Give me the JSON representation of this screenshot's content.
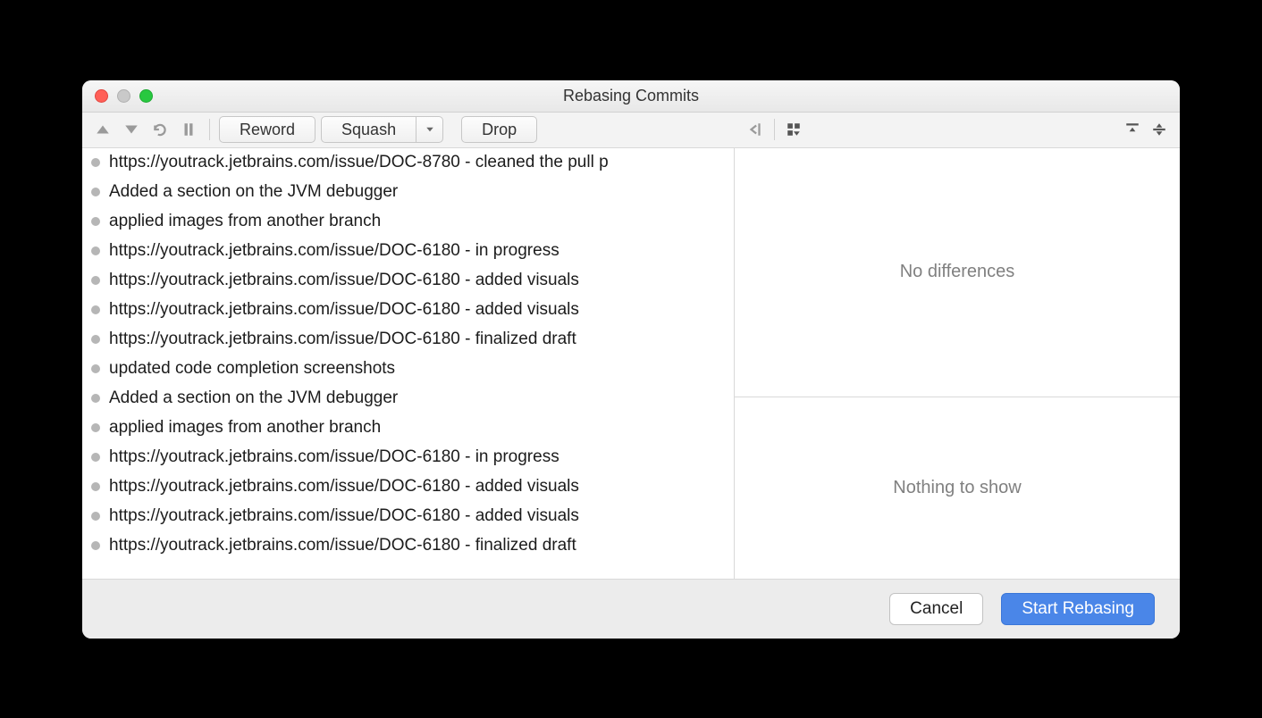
{
  "window": {
    "title": "Rebasing Commits"
  },
  "toolbar": {
    "reword": "Reword",
    "squash": "Squash",
    "drop": "Drop"
  },
  "commits": [
    "https://youtrack.jetbrains.com/issue/DOC-8780 - cleaned the pull p",
    "Added a section on the JVM debugger",
    "applied images from another branch",
    "https://youtrack.jetbrains.com/issue/DOC-6180 - in progress",
    "https://youtrack.jetbrains.com/issue/DOC-6180 - added visuals",
    "https://youtrack.jetbrains.com/issue/DOC-6180 - added visuals",
    "https://youtrack.jetbrains.com/issue/DOC-6180 - finalized draft",
    "updated code completion screenshots",
    "Added a section on the JVM debugger",
    "applied images from another branch",
    "https://youtrack.jetbrains.com/issue/DOC-6180 - in progress",
    "https://youtrack.jetbrains.com/issue/DOC-6180 - added visuals",
    "https://youtrack.jetbrains.com/issue/DOC-6180 - added visuals",
    "https://youtrack.jetbrains.com/issue/DOC-6180 - finalized draft"
  ],
  "diff": {
    "upper": "No differences",
    "lower": "Nothing to show"
  },
  "footer": {
    "cancel": "Cancel",
    "start": "Start Rebasing"
  }
}
